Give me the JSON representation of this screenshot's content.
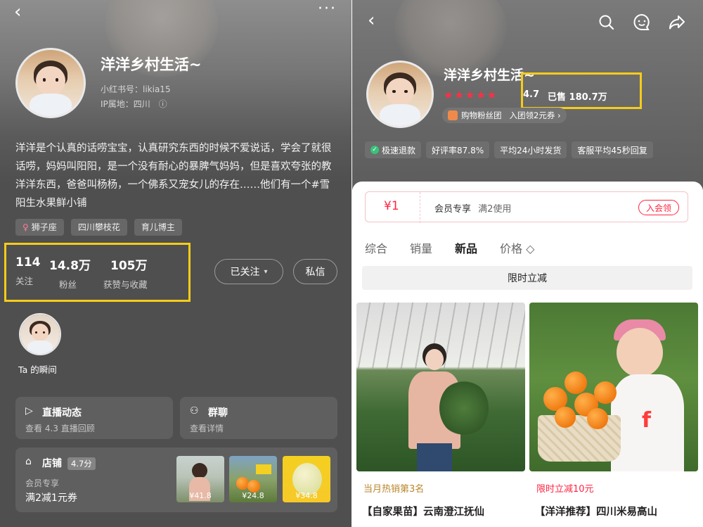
{
  "left": {
    "nav": {
      "back_icon": "‹",
      "more_icon": "···"
    },
    "profile": {
      "name": "洋洋乡村生活~",
      "red_id": "小红书号：likia15",
      "ip_location": "IP属地：四川",
      "info_icon": "ⓘ",
      "bio": "洋洋是个认真的话唠宝宝，认真研究东西的时候不爱说话，学会了就很话唠，妈妈叫阳阳，是一个没有耐心的暴脾气妈妈，但是喜欢夸张的教洋洋东西，爸爸叫杨杨，一个佛系又宠女儿的存在……他们有一个#雪阳生水果鲜小铺"
    },
    "tags": [
      {
        "symbol": "♀",
        "label": "狮子座"
      },
      {
        "symbol": "",
        "label": "四川攀枝花"
      },
      {
        "symbol": "",
        "label": "育儿博主"
      }
    ],
    "stats": [
      {
        "value": "114",
        "label": "关注"
      },
      {
        "value": "14.8万",
        "label": "粉丝"
      },
      {
        "value": "105万",
        "label": "获赞与收藏"
      }
    ],
    "buttons": {
      "follow": "已关注",
      "follow_caret": "▾",
      "message": "私信"
    },
    "moment_label": "Ta 的瞬间",
    "cards": {
      "live": {
        "icon": "▷",
        "title": "直播动态",
        "subtitle": "查看 4.3 直播回顾"
      },
      "group": {
        "icon": "⚇",
        "title": "群聊",
        "subtitle": "查看详情"
      },
      "shop": {
        "icon": "⌂",
        "title": "店铺",
        "rating_badge": "4.7分",
        "coupon_label": "会员专享",
        "coupon_detail": "满2减1元券",
        "thumbnails": [
          {
            "price": "¥41.8"
          },
          {
            "price": "¥24.8"
          },
          {
            "price": "¥34.8"
          }
        ]
      }
    }
  },
  "right": {
    "nav": {
      "back_icon": "‹",
      "search_icon": "⌕",
      "chat_icon": "☺",
      "share_icon": "➦"
    },
    "shop_name": "洋洋乡村生活~",
    "stars": "★★★★★",
    "rating": "4.7",
    "sold": "已售 180.7万",
    "fan_group": {
      "label": "购物粉丝团",
      "action": "入团领2元券 ›"
    },
    "services": [
      "极速退款",
      "好评率87.8%",
      "平均24小时发货",
      "客服平均45秒回复"
    ],
    "coupon": {
      "amount": "¥1",
      "title": "会员专享",
      "condition": "满2使用",
      "button": "入会领"
    },
    "sort_tabs": [
      "综合",
      "销量",
      "新品",
      "价格 ◇"
    ],
    "active_tab_index": 2,
    "limited_bar": "限时立减",
    "products": [
      {
        "tag": "当月热销第3名",
        "tag_color": "#b8862b",
        "title": "【自家果苗】云南澄江抚仙"
      },
      {
        "tag": "限时立减10元",
        "tag_color": "#ff2442",
        "title": "【洋洋推荐】四川米易高山"
      }
    ]
  },
  "colors": {
    "highlight_box": "#f6cc1a",
    "brand_red": "#ff2442",
    "star_red": "#ff2f45"
  }
}
